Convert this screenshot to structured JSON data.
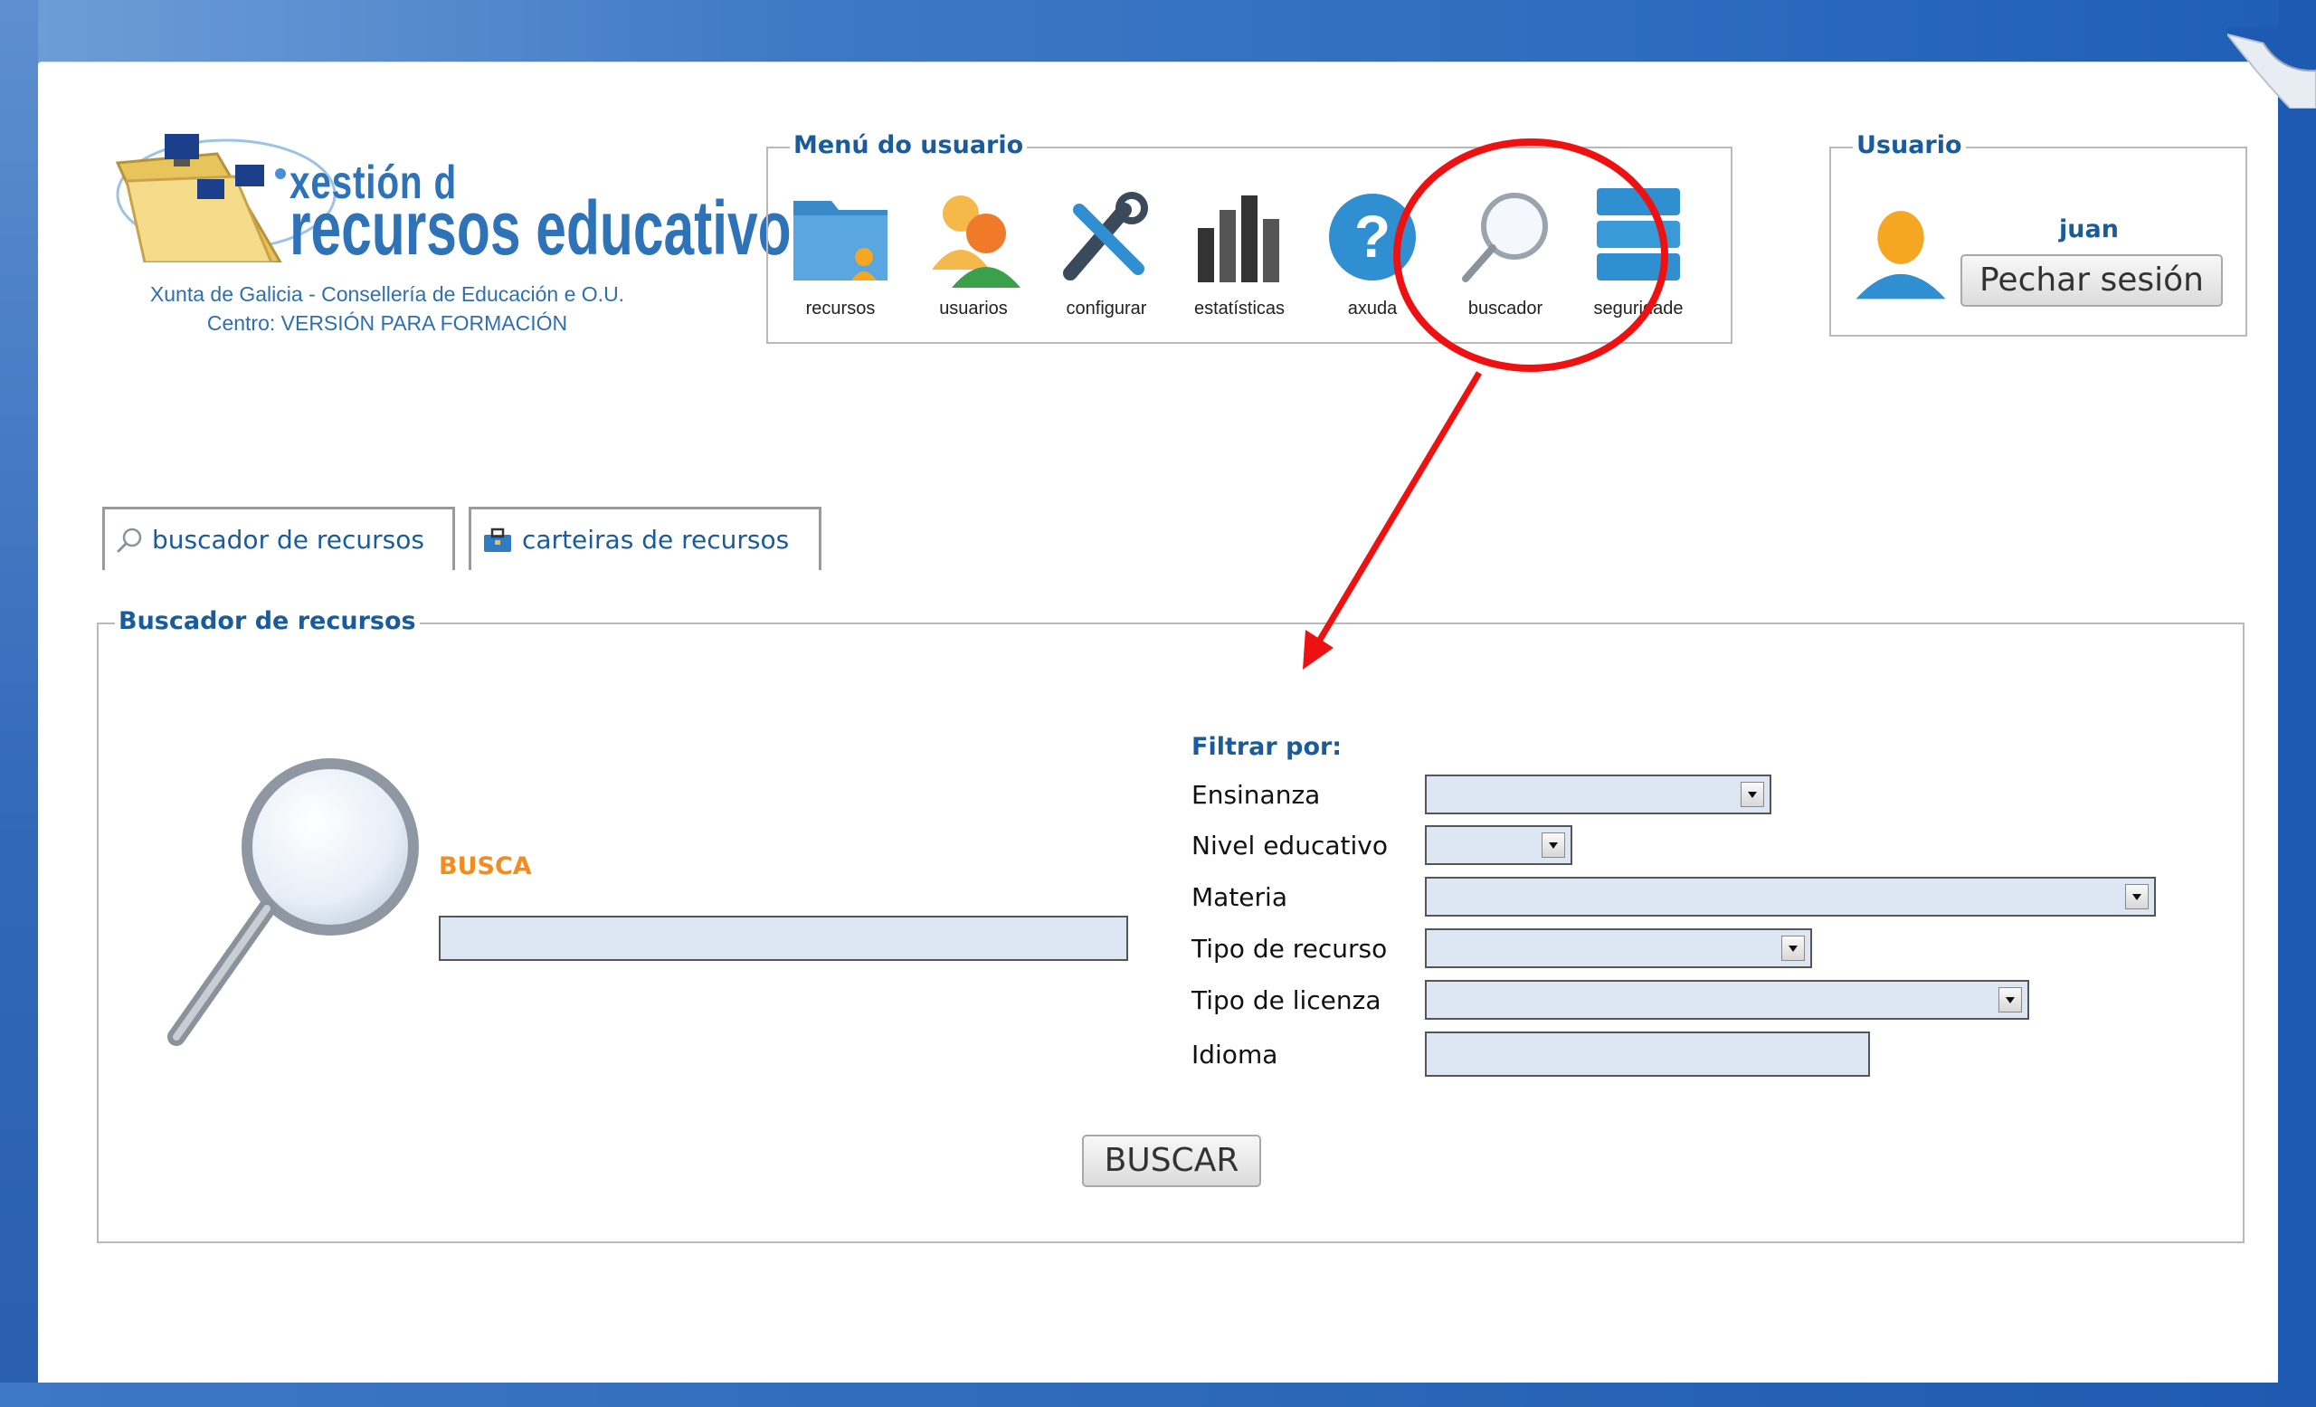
{
  "header": {
    "logo_line1": "xestión d",
    "logo_line2": "recursos educativos",
    "org": "Xunta de Galicia - Consellería de Educación e O.U.",
    "centre": "Centro: VERSIÓN PARA FORMACIÓN"
  },
  "menu": {
    "legend": "Menú do usuario",
    "items": [
      {
        "label": "recursos",
        "icon": "folder-user-icon"
      },
      {
        "label": "usuarios",
        "icon": "users-icon"
      },
      {
        "label": "configurar",
        "icon": "tools-icon"
      },
      {
        "label": "estatísticas",
        "icon": "bar-chart-icon"
      },
      {
        "label": "axuda",
        "icon": "help-icon"
      },
      {
        "label": "buscador",
        "icon": "magnifier-icon"
      },
      {
        "label": "seguridade",
        "icon": "database-icon"
      }
    ]
  },
  "user": {
    "legend": "Usuario",
    "name": "juan",
    "logout_label": "Pechar sesión"
  },
  "tabs": [
    {
      "label": "buscador de recursos",
      "icon": "magnifier-icon",
      "active": true
    },
    {
      "label": "carteiras de recursos",
      "icon": "briefcase-icon",
      "active": false
    }
  ],
  "search": {
    "legend": "Buscador de recursos",
    "busca_label": "BUSCA",
    "busca_value": "",
    "filter_title": "Filtrar por:",
    "filters": [
      {
        "label": "Ensinanza",
        "value": ""
      },
      {
        "label": "Nivel educativo",
        "value": ""
      },
      {
        "label": "Materia",
        "value": ""
      },
      {
        "label": "Tipo de recurso",
        "value": ""
      },
      {
        "label": "Tipo de licenza",
        "value": ""
      },
      {
        "label": "Idioma",
        "value": ""
      }
    ],
    "submit_label": "BUSCAR"
  },
  "colors": {
    "frame": "#2d6cbf",
    "accent": "#1a5c9b",
    "busca": "#f28c1f",
    "field": "#dde6f3",
    "annotation": "#ee1111"
  }
}
